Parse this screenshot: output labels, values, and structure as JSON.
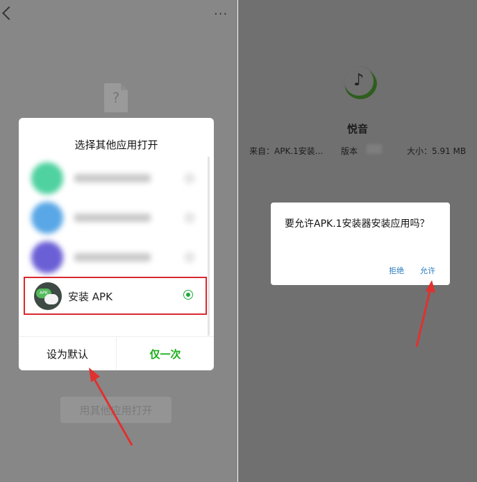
{
  "left": {
    "chooser": {
      "title": "选择其他应用打开",
      "selected_app_label": "安装 APK",
      "apk_icon_text": "APK",
      "set_default_label": "设为默认",
      "just_once_label": "仅一次"
    },
    "open_other_button_label": "用其他应用打开",
    "file_icon_glyph": "?",
    "more_glyph": "···",
    "accent_colors": {
      "green": "#1aad19",
      "highlight": "#d9272e"
    }
  },
  "right": {
    "app": {
      "name": "悦音",
      "source": "来自：APK.1安装...",
      "version_label": "版本",
      "size": "大小：5.91 MB"
    },
    "permission_dialog": {
      "message": "要允许APK.1安装器安装应用吗？",
      "deny_label": "拒绝",
      "allow_label": "允许",
      "link_color": "#2a7bbf"
    }
  },
  "annotation_color": "#e0312f"
}
